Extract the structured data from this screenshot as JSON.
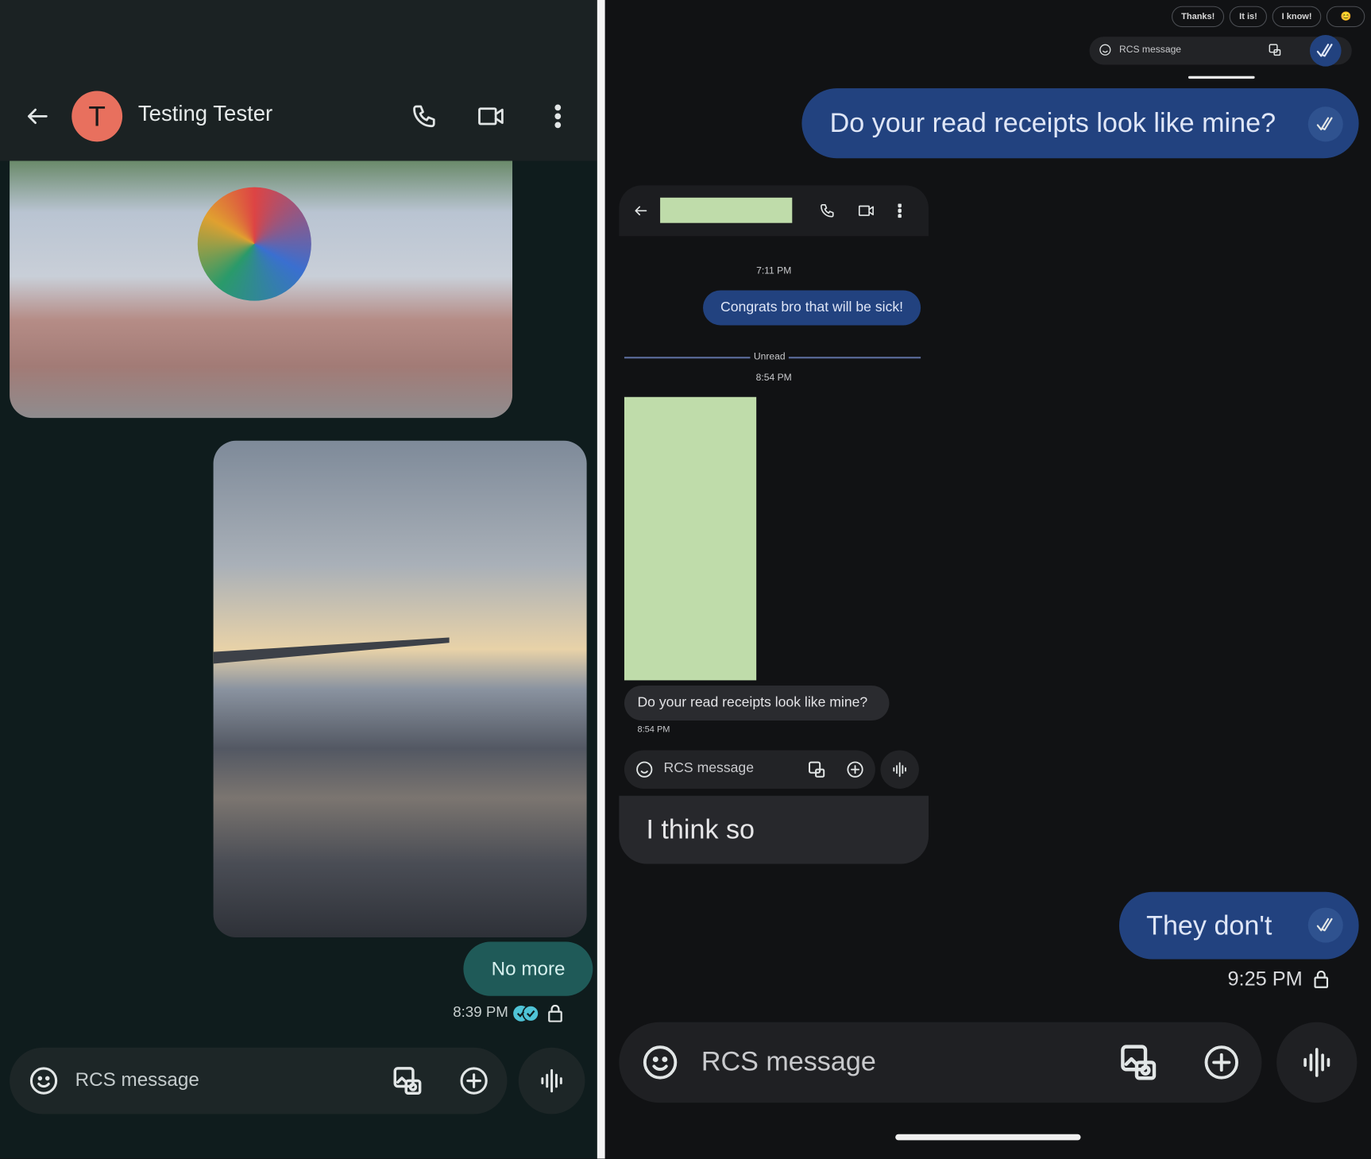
{
  "left_screen": {
    "header": {
      "avatar_letter": "T",
      "contact_name": "Testing Tester",
      "icons": [
        "back-arrow-icon",
        "phone-icon",
        "video-icon",
        "more-vert-icon"
      ]
    },
    "messages": [
      {
        "type": "image",
        "subject": "sculpture-photo"
      },
      {
        "type": "image",
        "subject": "airplane-wing-photo"
      },
      {
        "type": "text",
        "text": "No more",
        "time": "8:39 PM",
        "status": "read"
      }
    ],
    "compose": {
      "placeholder": "RCS message"
    },
    "colors": {
      "bubble": "#1f5a58",
      "read_receipt": "#4fc3d6",
      "avatar": "#e8705e"
    }
  },
  "right_screen": {
    "suggestions": [
      "Thanks!",
      "It is!",
      "I know!",
      "😊"
    ],
    "mini_compose": {
      "placeholder": "RCS message"
    },
    "top_message": {
      "text": "Do your read receipts look like mine?",
      "status": "read"
    },
    "inner_screenshot": {
      "timestamp1": "7:11 PM",
      "sent_message": "Congrats bro that will be sick!",
      "unread_label": "Unread",
      "timestamp2": "8:54 PM",
      "received_message": "Do your read receipts look like mine?",
      "received_time": "8:54 PM",
      "compose_placeholder": "RCS message"
    },
    "received_reply": "I think so",
    "sent_reply": {
      "text": "They don't",
      "time": "9:25 PM",
      "status": "read"
    },
    "compose": {
      "placeholder": "RCS message"
    },
    "colors": {
      "bubble": "#22427f",
      "redaction": "#bfdcaa"
    }
  }
}
